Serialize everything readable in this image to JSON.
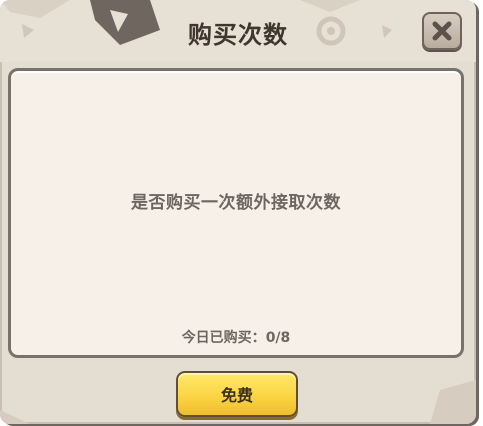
{
  "dialog": {
    "title": "购买次数",
    "message": "是否购买一次额外接取次数",
    "purchased_label": "今日已购买：",
    "purchased_count": "0/8",
    "free_button_label": "免费",
    "close_icon": "close-icon"
  },
  "colors": {
    "background": "#e4ddd1",
    "panel": "#f7f0e8",
    "button_yellow": "#fbd544",
    "text": "#6e6662"
  }
}
